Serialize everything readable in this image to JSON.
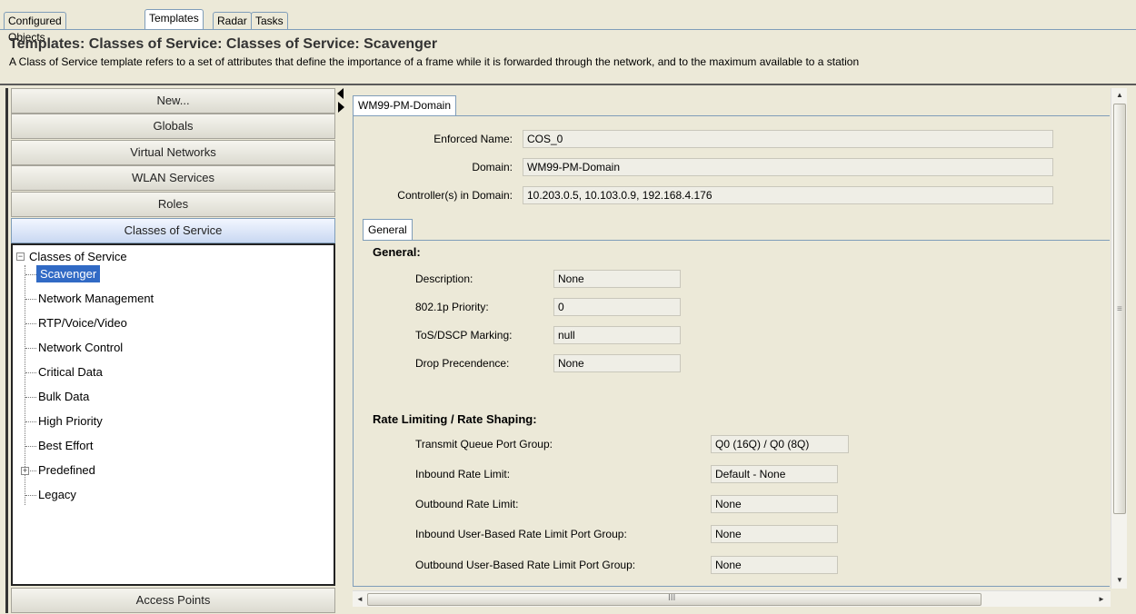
{
  "top_tabs": [
    "Configured Objects",
    "Templates",
    "Radar",
    "Tasks"
  ],
  "active_top_tab": "Templates",
  "header": {
    "title": "Templates: Classes of Service: Classes of Service: Scavenger",
    "description": "A Class of Service template refers to a set of attributes that define the importance of a frame while it is forwarded through the network, and to the maximum available to a station"
  },
  "nav": {
    "buttons": [
      "New...",
      "Globals",
      "Virtual Networks",
      "WLAN Services",
      "Roles",
      "Classes of Service"
    ],
    "active": "Classes of Service",
    "bottom_button": "Access Points"
  },
  "tree": {
    "root": "Classes of Service",
    "root_expander": "−",
    "children": [
      "Scavenger",
      "Network Management",
      "RTP/Voice/Video",
      "Network Control",
      "Critical Data",
      "Bulk Data",
      "High Priority",
      "Best Effort",
      "Predefined",
      "Legacy"
    ],
    "selected": "Scavenger",
    "predefined_expander": "+"
  },
  "domain_tab": "WM99-PM-Domain",
  "domain_fields": {
    "enforced_name_label": "Enforced Name:",
    "enforced_name": "COS_0",
    "domain_label": "Domain:",
    "domain": "WM99-PM-Domain",
    "controllers_label": "Controller(s) in Domain:",
    "controllers": "10.203.0.5, 10.103.0.9, 192.168.4.176"
  },
  "general_tab": "General",
  "general": {
    "section_title": "General:",
    "description_label": "Description:",
    "description": "None",
    "priority_label": "802.1p Priority:",
    "priority": "0",
    "tos_label": "ToS/DSCP Marking:",
    "tos": "null",
    "drop_label": "Drop Precendence:",
    "drop": "None"
  },
  "rate": {
    "section_title": "Rate Limiting / Rate Shaping:",
    "txq_label": "Transmit Queue Port Group:",
    "txq": "Q0 (16Q) / Q0 (8Q)",
    "inbound_label": "Inbound Rate Limit:",
    "inbound": "Default - None",
    "outbound_label": "Outbound Rate Limit:",
    "outbound": "None",
    "in_user_label": "Inbound User-Based Rate Limit Port Group:",
    "in_user": "None",
    "out_user_label": "Outbound User-Based Rate Limit Port Group:",
    "out_user": "None"
  },
  "scroll_glyphs": {
    "up": "▲",
    "down": "▼",
    "left": "◄",
    "right": "►",
    "vgrip": "≡",
    "hgrip": "III"
  }
}
